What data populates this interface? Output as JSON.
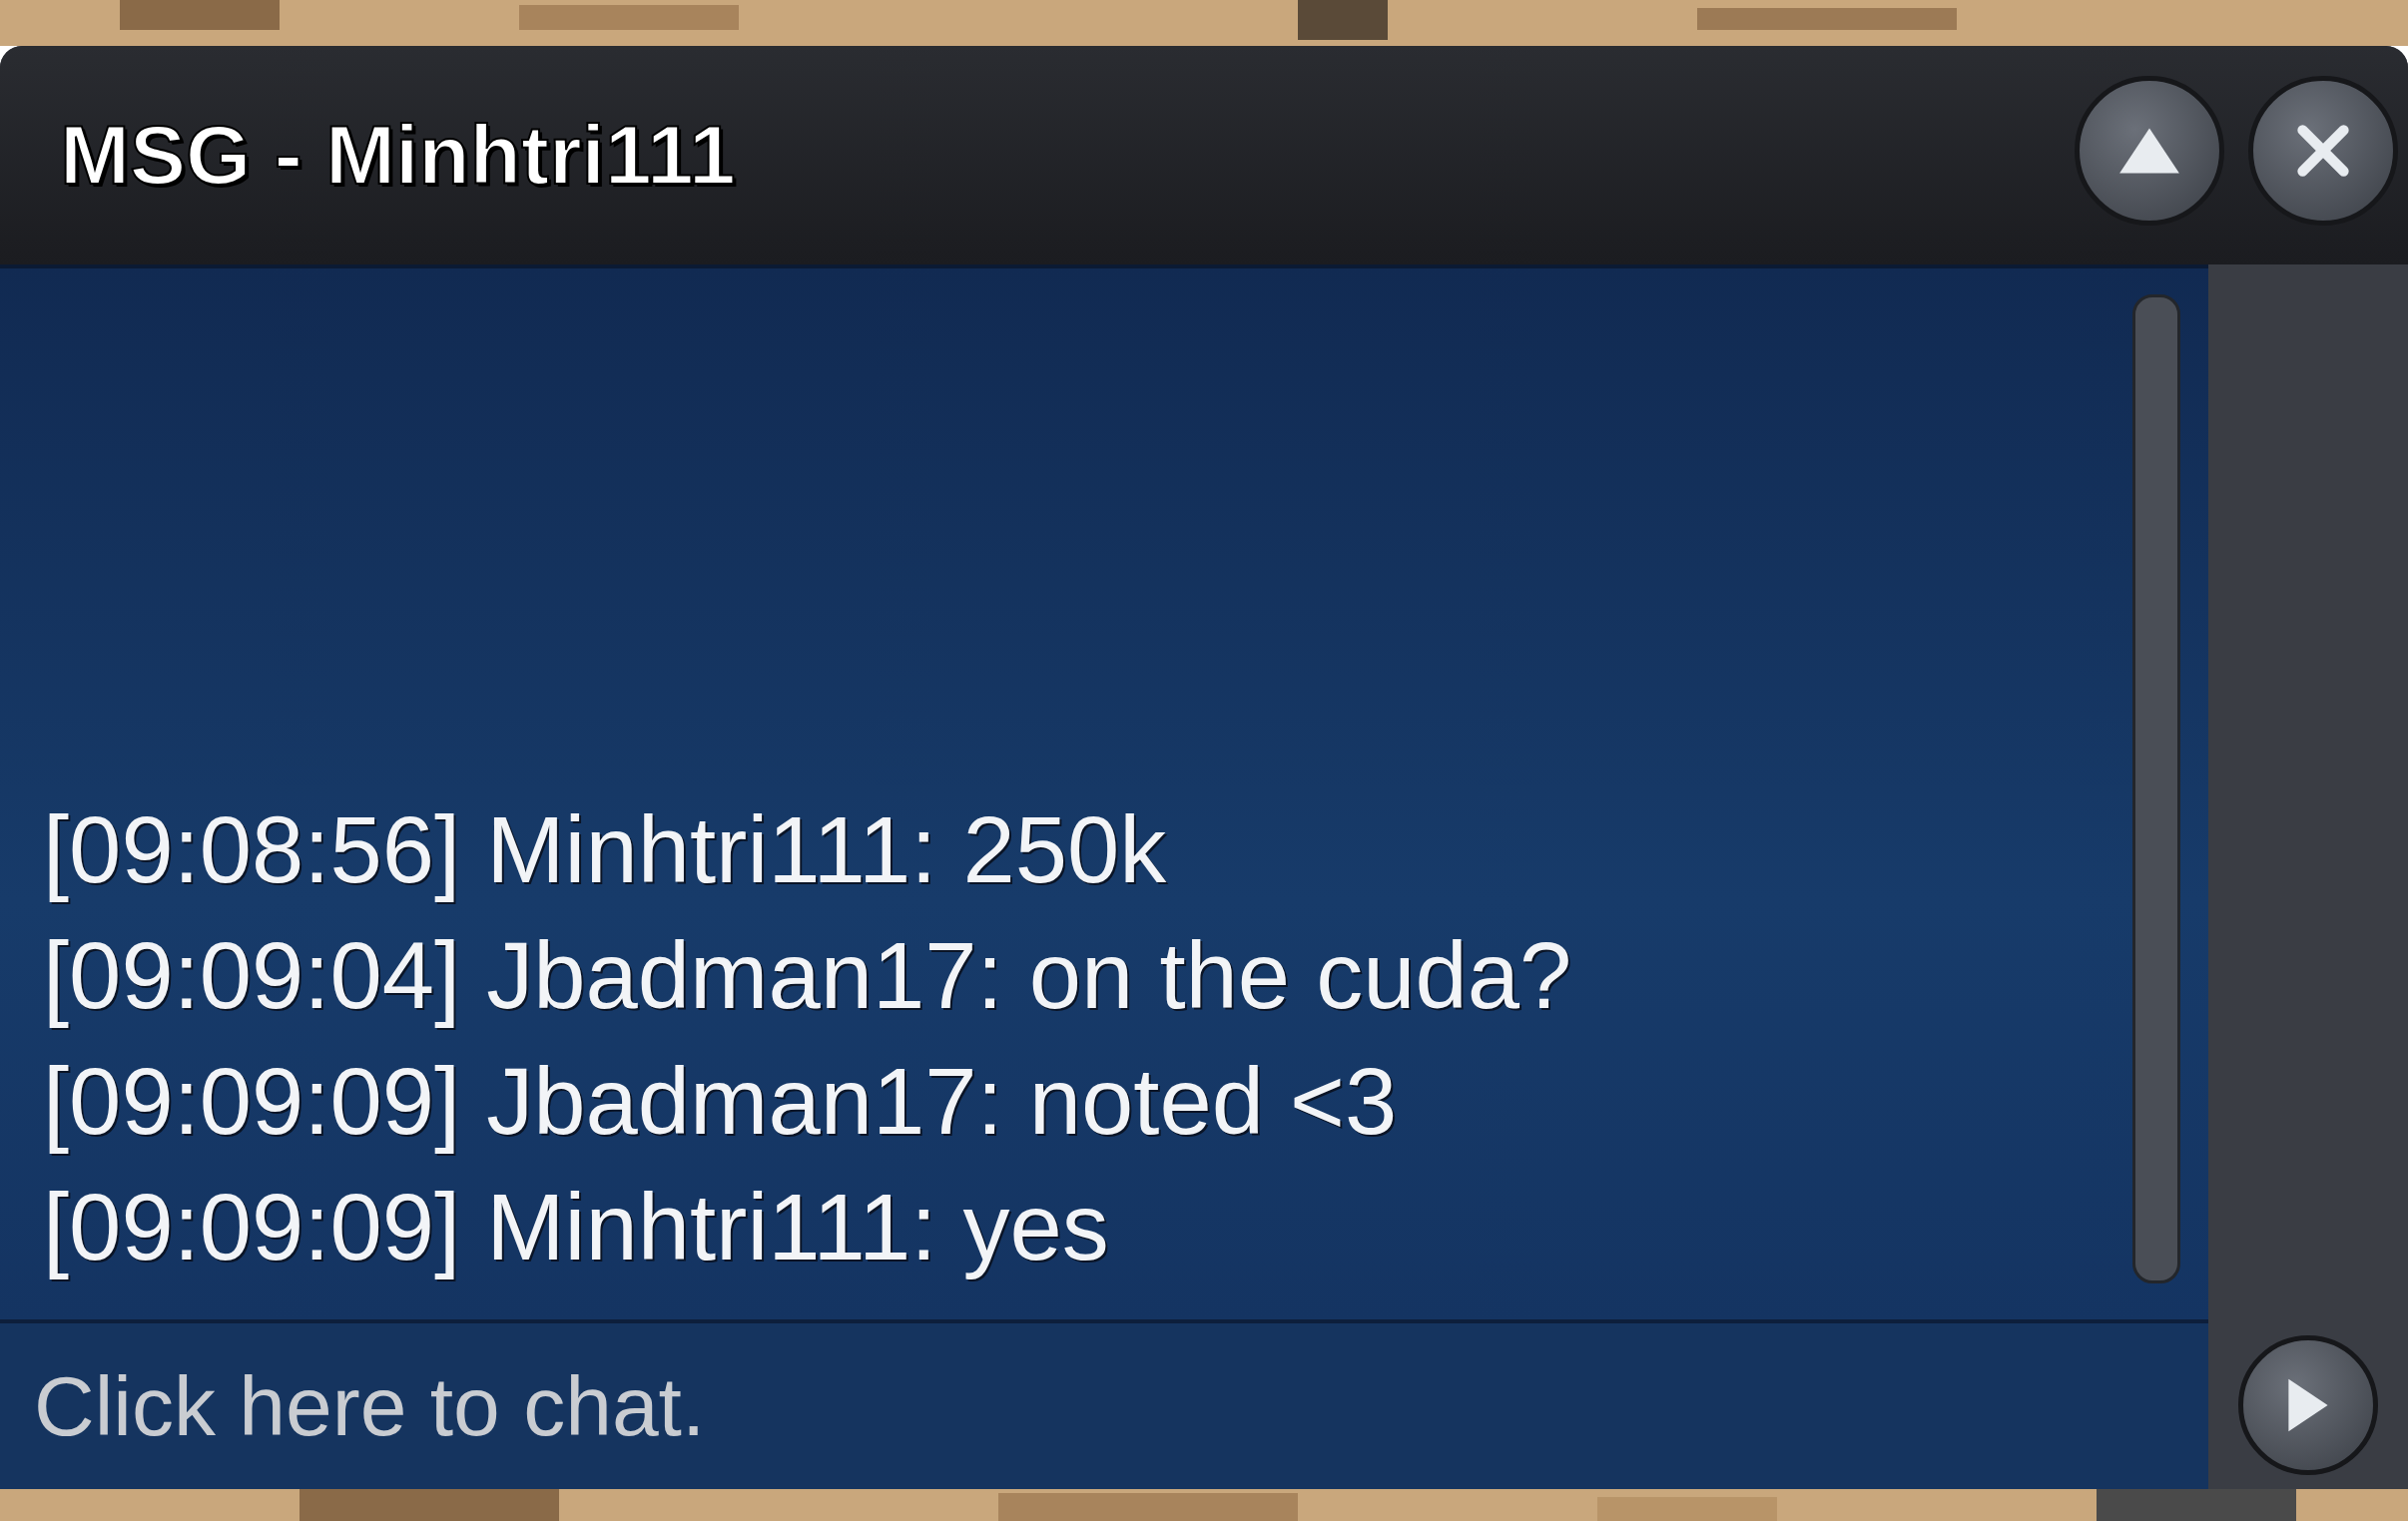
{
  "window": {
    "title": "MSG - Minhtri111"
  },
  "messages": [
    {
      "text": "[09:08:56] Minhtri111: 250k"
    },
    {
      "text": "[09:09:04] Jbadman17: on the cuda?"
    },
    {
      "text": "[09:09:09] Jbadman17: noted <3"
    },
    {
      "text": "[09:09:09] Minhtri111: yes"
    }
  ],
  "chat_input": {
    "placeholder": "Click here to chat."
  }
}
